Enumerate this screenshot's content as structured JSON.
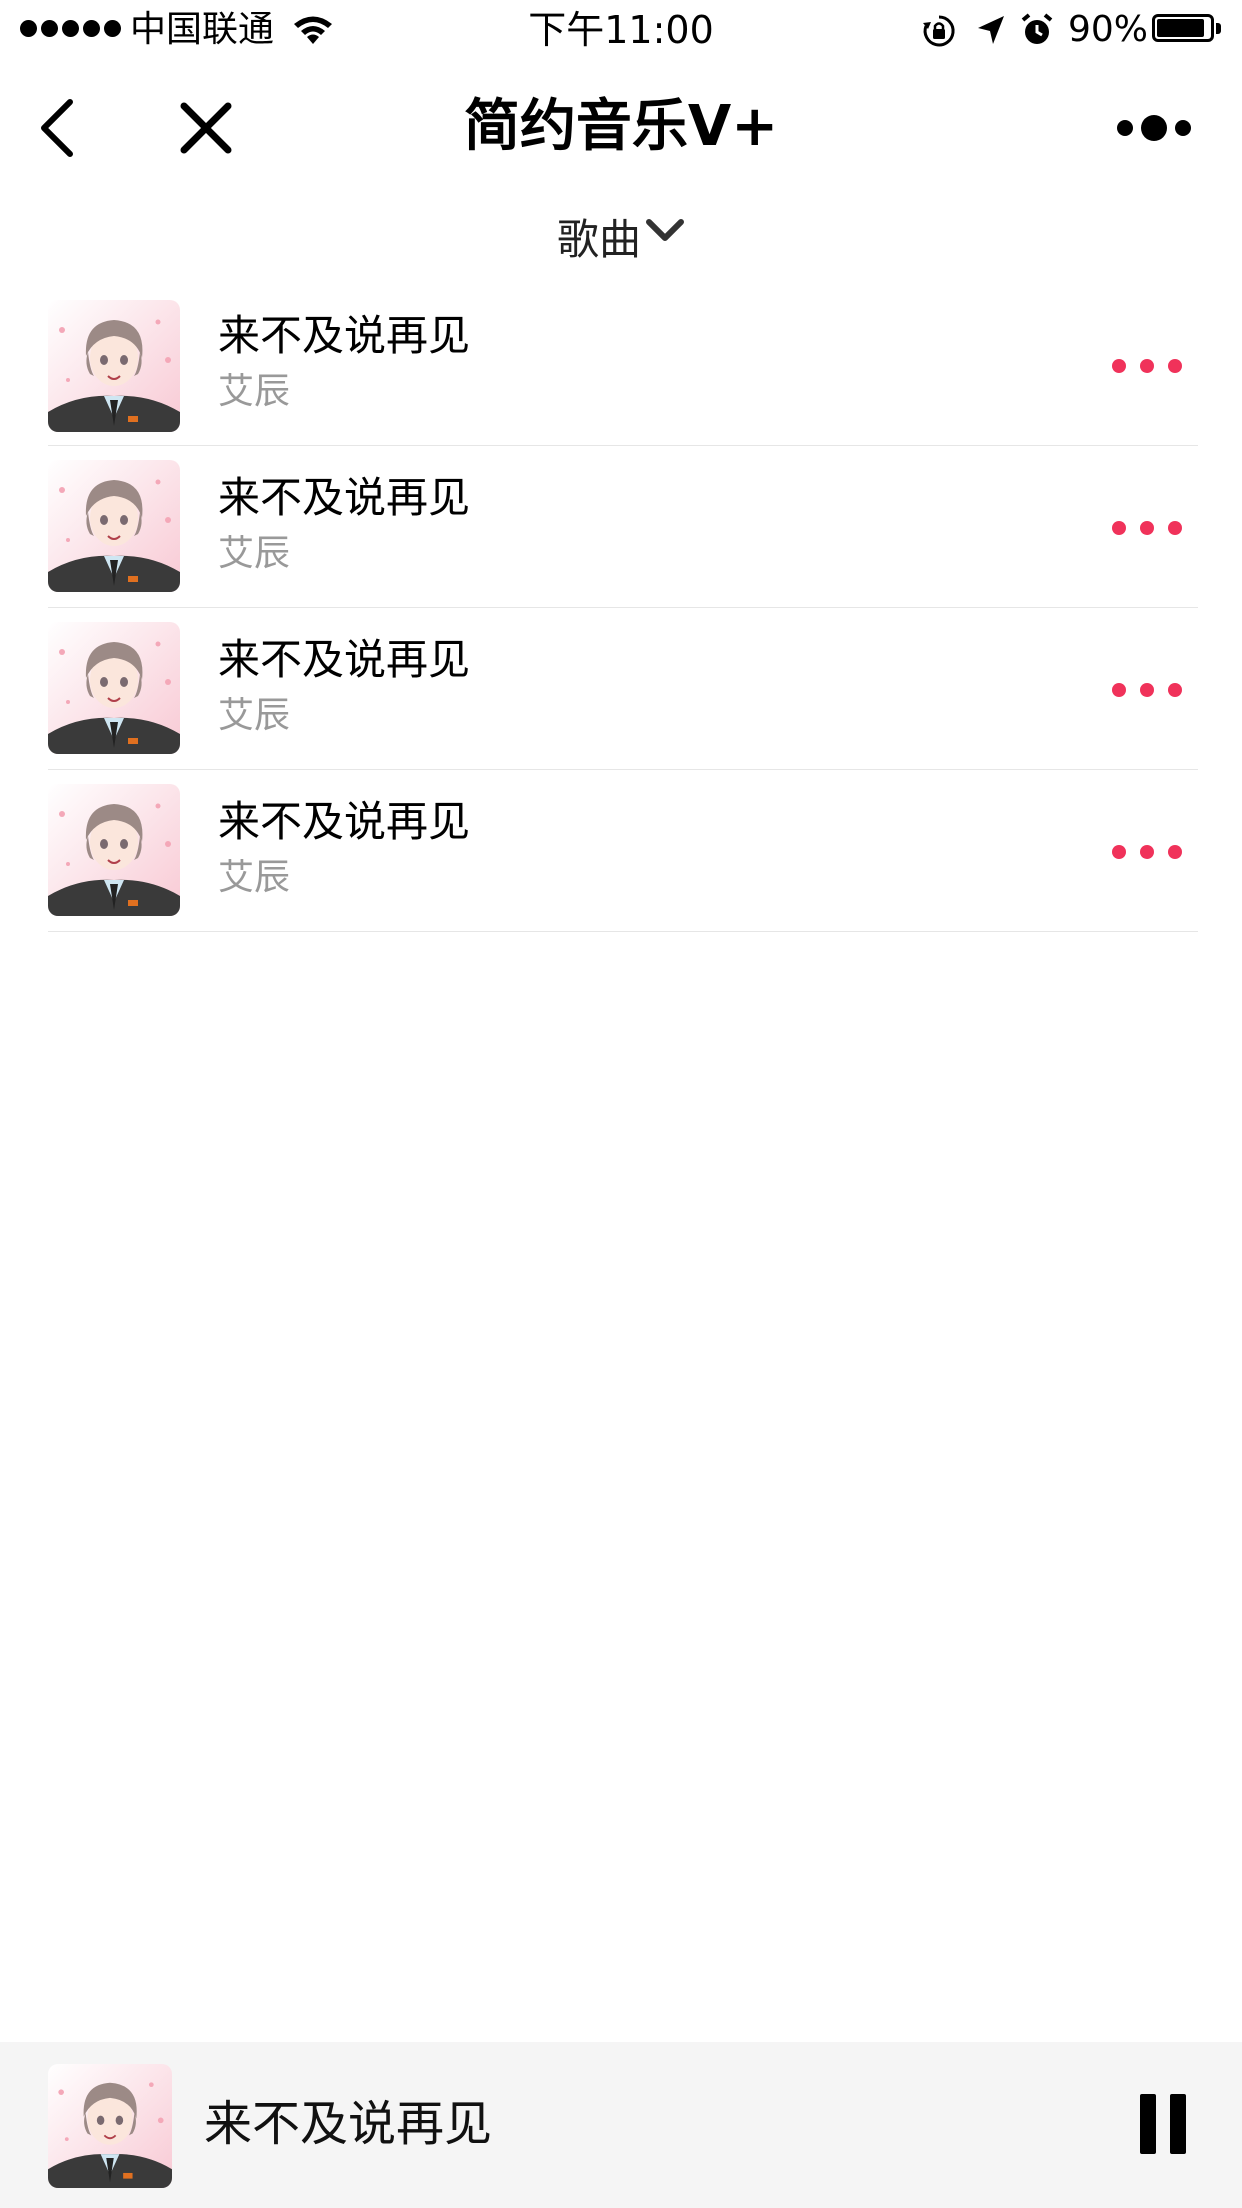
{
  "status_bar": {
    "carrier": "中国联通",
    "time": "下午11:00",
    "battery": "90%",
    "battery_level": 0.9,
    "icons": [
      "signal-dots-icon",
      "wifi-icon",
      "rotation-lock-icon",
      "location-arrow-icon",
      "alarm-icon",
      "battery-icon"
    ]
  },
  "nav": {
    "title": "简约音乐V+",
    "icons": [
      "back-arrow-icon",
      "close-icon",
      "more-icon"
    ]
  },
  "category": {
    "label": "歌曲",
    "icon": "chevron-down-icon"
  },
  "songs": [
    {
      "title": "来不及说再见",
      "artist": "艾辰",
      "cover": "album-cover-image",
      "more_icon": "more-dots-icon"
    },
    {
      "title": "来不及说再见",
      "artist": "艾辰",
      "cover": "album-cover-image",
      "more_icon": "more-dots-icon"
    },
    {
      "title": "来不及说再见",
      "artist": "艾辰",
      "cover": "album-cover-image",
      "more_icon": "more-dots-icon"
    },
    {
      "title": "来不及说再见",
      "artist": "艾辰",
      "cover": "album-cover-image",
      "more_icon": "more-dots-icon"
    }
  ],
  "player": {
    "title": "来不及说再见",
    "cover": "album-cover-image",
    "control_icon": "pause-icon"
  },
  "colors": {
    "accent": "#f0325a",
    "secondary_text": "#999999",
    "player_bg": "#f5f5f5",
    "divider": "#e6e6e6"
  }
}
